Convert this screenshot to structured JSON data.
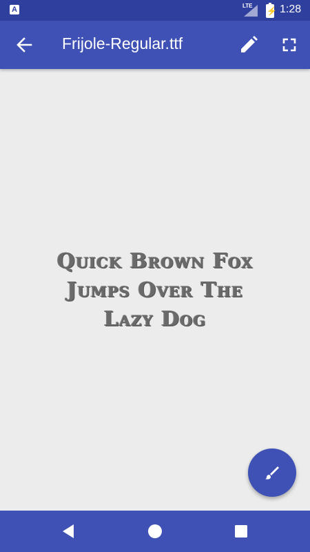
{
  "status_bar": {
    "app_icon": "A",
    "network": "LTE",
    "time": "1:28",
    "icons": [
      "app-notification-icon",
      "lte-signal-icon",
      "battery-charging-icon"
    ]
  },
  "app_bar": {
    "title": "Frijole-Regular.ttf",
    "icons": [
      "arrow-back-icon",
      "pencil-icon",
      "fullscreen-icon"
    ]
  },
  "preview": {
    "lines": [
      "Quick Brown Fox",
      "Jumps Over The",
      "Lazy Dog"
    ]
  },
  "fab": {
    "icon": "brush-icon"
  },
  "nav_bar": {
    "icons": [
      "triangle-back-icon",
      "circle-home-icon",
      "square-recents-icon"
    ]
  },
  "colors": {
    "primary": "#3f51b5",
    "primary_dark": "#2f3f9e",
    "background": "#ececec",
    "preview_text": "#6a6a6a"
  }
}
